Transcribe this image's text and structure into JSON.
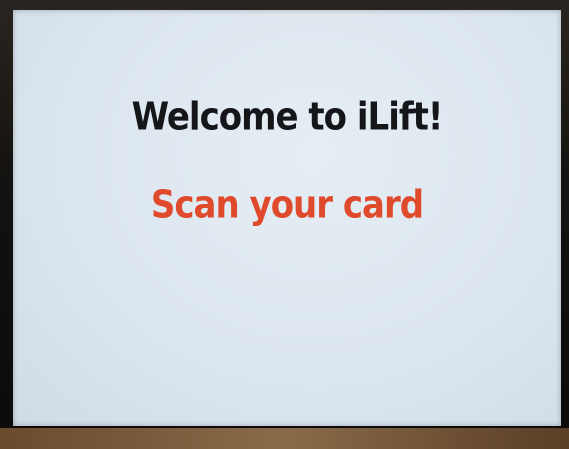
{
  "screen": {
    "title": "Welcome to iLift!",
    "prompt": "Scan your card"
  },
  "colors": {
    "title": "#14161a",
    "prompt": "#e04a2c",
    "screen_background": "#dbe5ee"
  }
}
